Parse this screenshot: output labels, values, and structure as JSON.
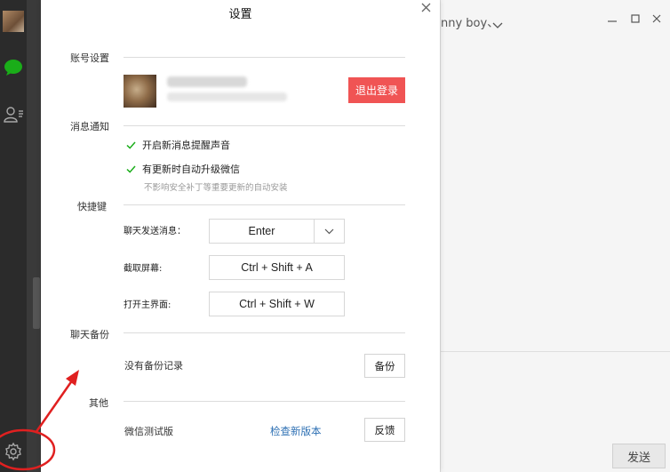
{
  "background_chat": {
    "title": "nny boy、",
    "send_label": "发送"
  },
  "dialog": {
    "title": "设置",
    "account": {
      "section_label": "账号设置",
      "name": "████",
      "logout_label": "退出登录"
    },
    "notifications": {
      "section_label": "消息通知",
      "option1": "开启新消息提醒声音",
      "option1_checked": true,
      "option2": "有更新时自动升级微信",
      "option2_checked": true,
      "hint": "不影响安全补丁等重要更新的自动安装"
    },
    "shortcuts": {
      "section_label": "快捷键",
      "send_label": "聊天发送消息：",
      "send_value": "Enter",
      "screenshot_label": "截取屏幕:",
      "screenshot_value": "Ctrl + Shift + A",
      "open_label": "打开主界面:",
      "open_value": "Ctrl + Shift + W"
    },
    "backup": {
      "section_label": "聊天备份",
      "status": "没有备份记录",
      "button_label": "备份"
    },
    "other": {
      "section_label": "其他",
      "version_label": "微信测试版",
      "check_update": "检查新版本",
      "feedback_label": "反馈"
    }
  },
  "colors": {
    "sidebar": "#2b2b2b",
    "wechat_green": "#1aad19",
    "logout_red": "#f05454",
    "link_blue": "#2c6fb3",
    "annotation_red": "#e02020"
  },
  "icons": [
    "chat-icon",
    "contacts-icon",
    "settings-gear-icon",
    "check-icon",
    "chevron-down-icon",
    "close-icon"
  ]
}
